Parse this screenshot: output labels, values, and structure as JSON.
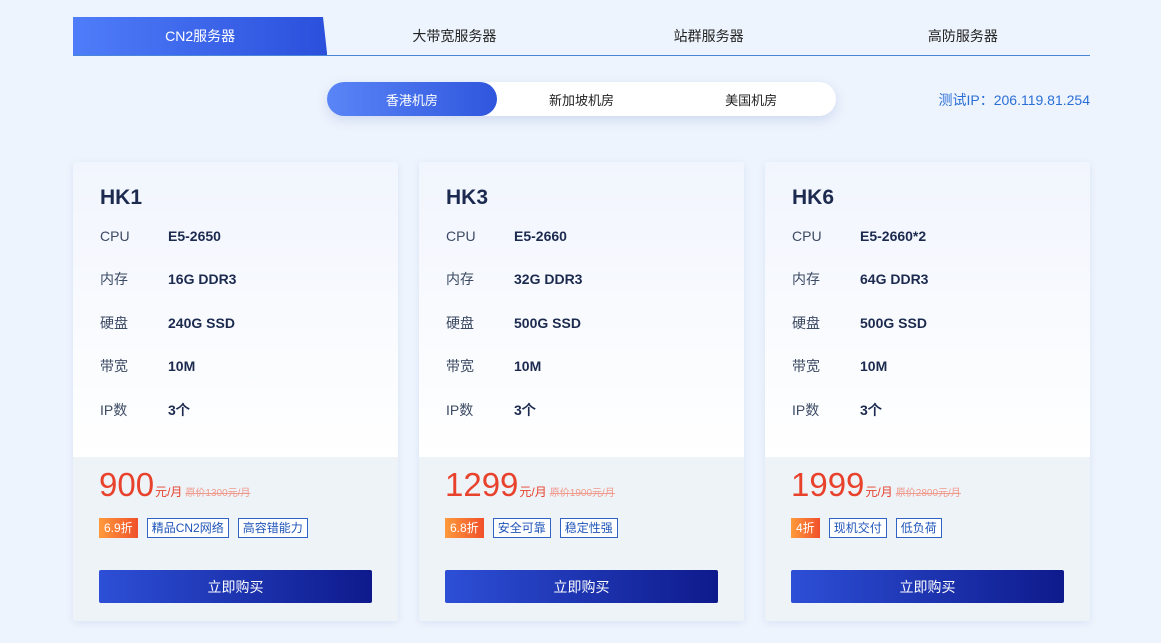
{
  "category_tabs": [
    {
      "label": "CN2服务器",
      "active": true
    },
    {
      "label": "大带宽服务器",
      "active": false
    },
    {
      "label": "站群服务器",
      "active": false
    },
    {
      "label": "高防服务器",
      "active": false
    }
  ],
  "region_tabs": [
    {
      "label": "香港机房",
      "active": true
    },
    {
      "label": "新加坡机房",
      "active": false
    },
    {
      "label": "美国机房",
      "active": false
    }
  ],
  "test_ip": "测试IP：206.119.81.254",
  "spec_labels": {
    "cpu": "CPU",
    "memory": "内存",
    "disk": "硬盘",
    "bandwidth": "带宽",
    "ips": "IP数"
  },
  "cards": [
    {
      "title": "HK1",
      "cpu": "E5-2650",
      "memory": "16G DDR3",
      "disk": "240G SSD",
      "bandwidth": "10M",
      "ips": "3个",
      "price": "900",
      "price_unit": "元/月",
      "price_old": "原价1300元/月",
      "discount": "6.9折",
      "tags": [
        "精品CN2网络",
        "高容错能力"
      ],
      "buy_label": "立即购买"
    },
    {
      "title": "HK3",
      "cpu": "E5-2660",
      "memory": "32G DDR3",
      "disk": "500G SSD",
      "bandwidth": "10M",
      "ips": "3个",
      "price": "1299",
      "price_unit": "元/月",
      "price_old": "原价1900元/月",
      "discount": "6.8折",
      "tags": [
        "安全可靠",
        "稳定性强"
      ],
      "buy_label": "立即购买"
    },
    {
      "title": "HK6",
      "cpu": "E5-2660*2",
      "memory": "64G DDR3",
      "disk": "500G SSD",
      "bandwidth": "10M",
      "ips": "3个",
      "price": "1999",
      "price_unit": "元/月",
      "price_old": "原价2800元/月",
      "discount": "4折",
      "tags": [
        "现机交付",
        "低负荷"
      ],
      "buy_label": "立即购买"
    }
  ],
  "colors": {
    "accent": "#2f56dd",
    "price": "#e8412c",
    "ip_text": "#2a6fd6"
  }
}
